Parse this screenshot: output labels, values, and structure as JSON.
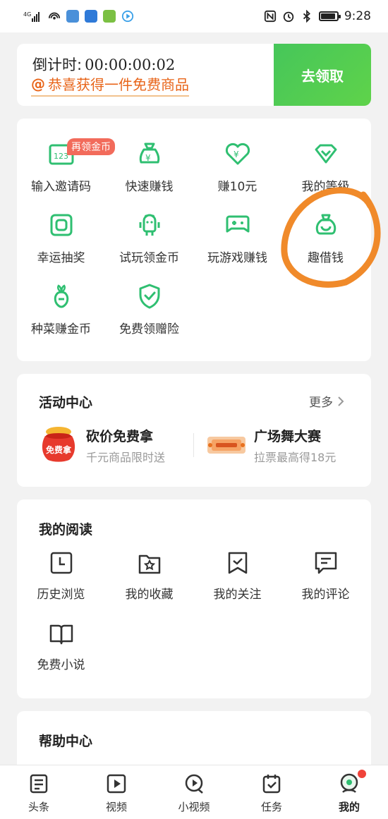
{
  "status_bar": {
    "network": "4G",
    "time": "9:28"
  },
  "banner": {
    "countdown_label": "倒计时:",
    "countdown_value": "00:00:00:02",
    "congrats_at": "@",
    "congrats_text": "恭喜获得一件免费商品",
    "claim_label": "去领取"
  },
  "grid": {
    "badge": "再领金币",
    "items": [
      {
        "label": "输入邀请码",
        "icon": "invite-code-icon"
      },
      {
        "label": "快速赚钱",
        "icon": "money-bag-icon"
      },
      {
        "label": "赚10元",
        "icon": "yen-heart-icon"
      },
      {
        "label": "我的等级",
        "icon": "diamond-level-icon"
      },
      {
        "label": "幸运抽奖",
        "icon": "lottery-icon"
      },
      {
        "label": "试玩领金币",
        "icon": "android-robot-icon"
      },
      {
        "label": "玩游戏赚钱",
        "icon": "gamepad-icon"
      },
      {
        "label": "趣借钱",
        "icon": "loan-bag-icon"
      },
      {
        "label": "种菜赚金币",
        "icon": "vegetable-icon"
      },
      {
        "label": "免费领赠险",
        "icon": "insurance-shield-icon"
      }
    ]
  },
  "activity": {
    "title": "活动中心",
    "more": "更多",
    "items": [
      {
        "title": "砍价免费拿",
        "sub": "千元商品限时送",
        "badge": "免费拿"
      },
      {
        "title": "广场舞大赛",
        "sub": "拉票最高得18元"
      }
    ]
  },
  "reading": {
    "title": "我的阅读",
    "items": [
      {
        "label": "历史浏览",
        "icon": "clock-icon"
      },
      {
        "label": "我的收藏",
        "icon": "star-folder-icon"
      },
      {
        "label": "我的关注",
        "icon": "bookmark-check-icon"
      },
      {
        "label": "我的评论",
        "icon": "comment-icon"
      },
      {
        "label": "免费小说",
        "icon": "open-book-icon"
      }
    ]
  },
  "help": {
    "title": "帮助中心"
  },
  "bottom_nav": {
    "items": [
      {
        "label": "头条",
        "icon": "news-icon"
      },
      {
        "label": "视频",
        "icon": "video-play-icon"
      },
      {
        "label": "小视频",
        "icon": "short-video-icon"
      },
      {
        "label": "任务",
        "icon": "task-icon"
      },
      {
        "label": "我的",
        "icon": "profile-icon"
      }
    ],
    "active_index": 4
  },
  "colors": {
    "brand_green": "#2fbf71",
    "orange": "#e8651a",
    "annotation": "#f08a2a"
  }
}
